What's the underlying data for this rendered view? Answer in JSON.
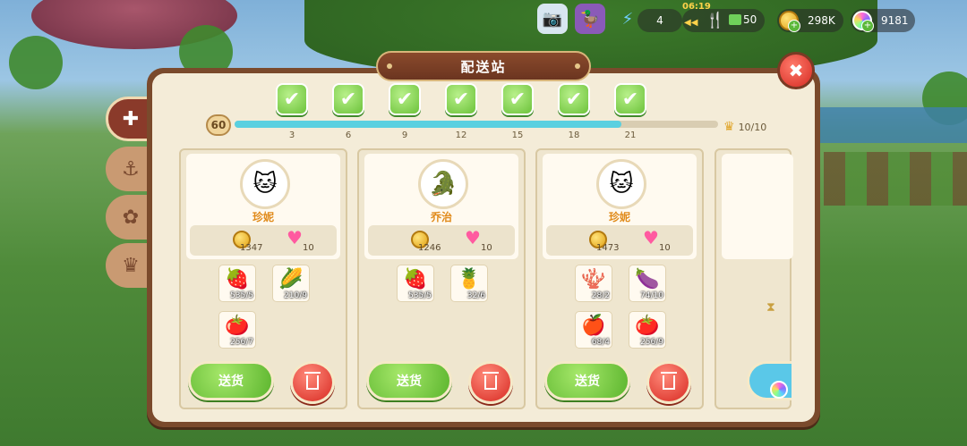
{
  "hud": {
    "energy_value": "4",
    "timer": "06:19",
    "food_value": "50",
    "coins": "298K",
    "gems": "9181"
  },
  "panel": {
    "title": "配送站"
  },
  "progress": {
    "level": "60",
    "fill_fraction": 0.8,
    "ticks": [
      "3",
      "6",
      "9",
      "12",
      "15",
      "18",
      "21"
    ],
    "crowns": "10/10"
  },
  "orders": [
    {
      "npc": "珍妮",
      "coin_reward": "1347",
      "heart_reward": "10",
      "items": [
        {
          "icon": "raspberry",
          "qty": "535/5"
        },
        {
          "icon": "corn",
          "qty": "210/9"
        },
        {
          "icon": "tomato",
          "qty": "256/7"
        }
      ],
      "deliver_label": "送货"
    },
    {
      "npc": "乔治",
      "coin_reward": "1246",
      "heart_reward": "10",
      "items": [
        {
          "icon": "raspberry",
          "qty": "535/5"
        },
        {
          "icon": "pineapple",
          "qty": "32/6"
        }
      ],
      "deliver_label": "送货"
    },
    {
      "npc": "珍妮",
      "coin_reward": "1473",
      "heart_reward": "10",
      "items": [
        {
          "icon": "coral-plant",
          "qty": "28/2"
        },
        {
          "icon": "eggplant",
          "qty": "74/10"
        },
        {
          "icon": "apple",
          "qty": "68/4"
        },
        {
          "icon": "tomato",
          "qty": "256/9"
        }
      ],
      "deliver_label": "送货"
    }
  ],
  "colors": {
    "accent_green": "#5cb52e",
    "trash_red": "#d82a22",
    "panel_brown": "#7a4a2c",
    "progress_cyan": "#5ad0e0"
  }
}
